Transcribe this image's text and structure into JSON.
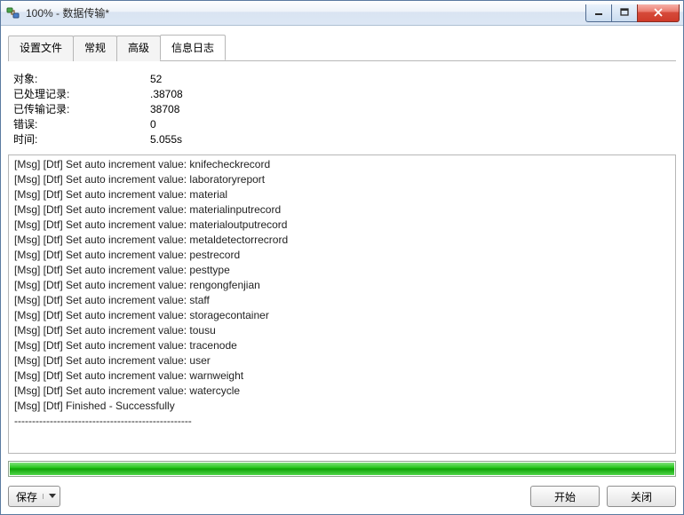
{
  "window": {
    "title": "100% - 数据传输*"
  },
  "tabs": [
    {
      "label": "设置文件",
      "active": false
    },
    {
      "label": "常规",
      "active": false
    },
    {
      "label": "高级",
      "active": false
    },
    {
      "label": "信息日志",
      "active": true
    }
  ],
  "stats": {
    "rows": [
      {
        "label": "对象:",
        "value": "52"
      },
      {
        "label": "已处理记录:",
        "value": ".38708"
      },
      {
        "label": "已传输记录:",
        "value": "38708"
      },
      {
        "label": "错误:",
        "value": "0"
      },
      {
        "label": "时间:",
        "value": "5.055s"
      }
    ]
  },
  "log_lines": [
    "[Msg] [Dtf] Set auto increment value: knifecheckrecord",
    "[Msg] [Dtf] Set auto increment value: laboratoryreport",
    "[Msg] [Dtf] Set auto increment value: material",
    "[Msg] [Dtf] Set auto increment value: materialinputrecord",
    "[Msg] [Dtf] Set auto increment value: materialoutputrecord",
    "[Msg] [Dtf] Set auto increment value: metaldetectorrecrord",
    "[Msg] [Dtf] Set auto increment value: pestrecord",
    "[Msg] [Dtf] Set auto increment value: pesttype",
    "[Msg] [Dtf] Set auto increment value: rengongfenjian",
    "[Msg] [Dtf] Set auto increment value: staff",
    "[Msg] [Dtf] Set auto increment value: storagecontainer",
    "[Msg] [Dtf] Set auto increment value: tousu",
    "[Msg] [Dtf] Set auto increment value: tracenode",
    "[Msg] [Dtf] Set auto increment value: user",
    "[Msg] [Dtf] Set auto increment value: warnweight",
    "[Msg] [Dtf] Set auto increment value: watercycle",
    "[Msg] [Dtf] Finished - Successfully",
    "--------------------------------------------------"
  ],
  "progress": {
    "percent": 100
  },
  "buttons": {
    "save": "保存",
    "start": "开始",
    "close": "关闭"
  }
}
